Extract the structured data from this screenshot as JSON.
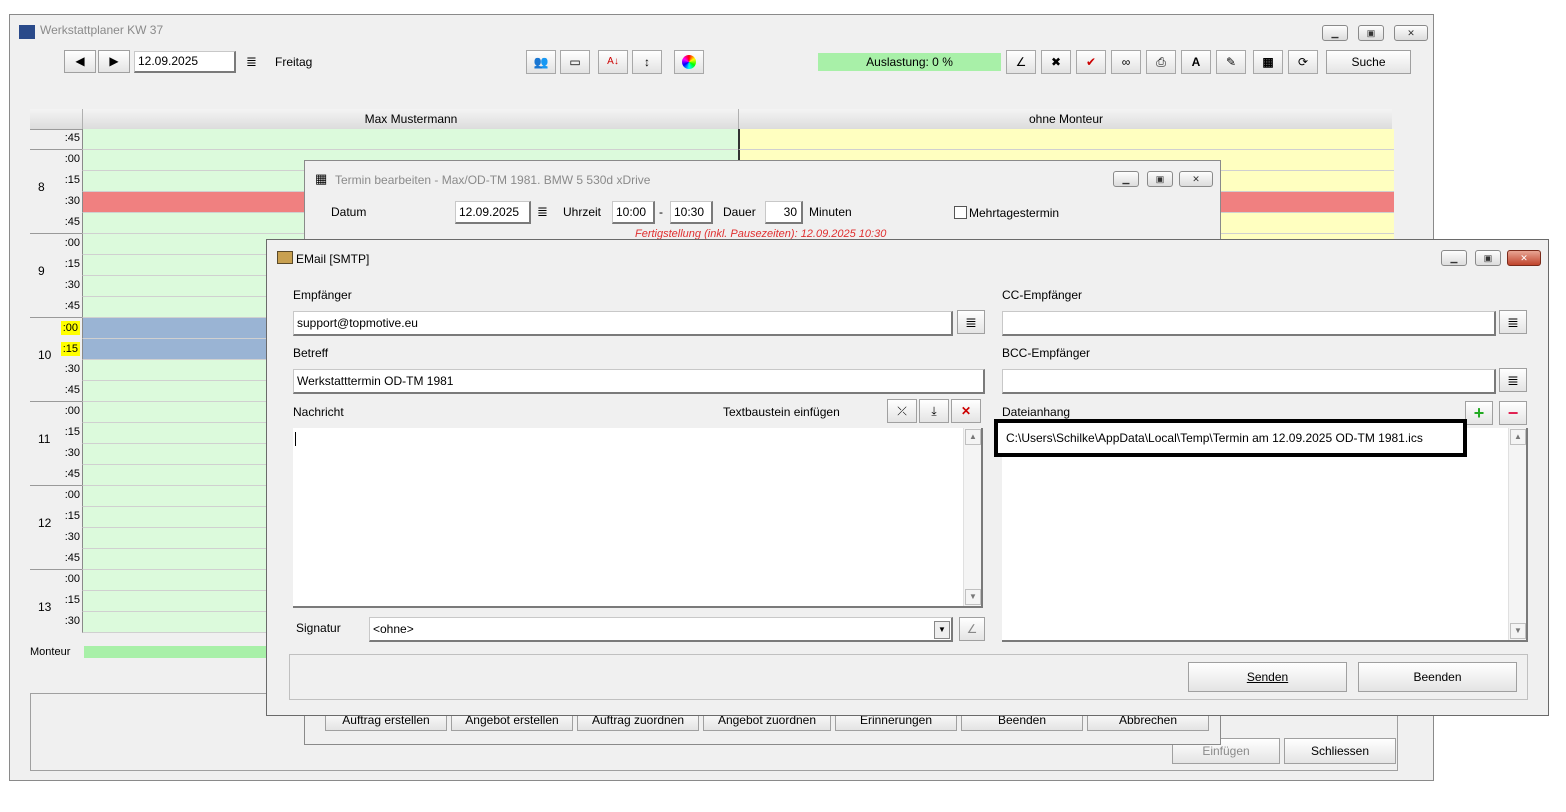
{
  "main": {
    "title": "Werkstattplaner KW 37",
    "date": "12.09.2025",
    "weekday": "Freitag",
    "auslastung": "Auslastung: 0 %",
    "suche_label": "Suche",
    "col1": "Max Mustermann",
    "col2": "ohne Monteur",
    "monteur_label": "Monteur",
    "einfuegen_label": "Einfügen",
    "schliessen_label": "Schliessen",
    "hours": [
      "8",
      "9",
      "10",
      "11",
      "12",
      "13"
    ],
    "slots": [
      ":45",
      ":00",
      ":15",
      ":30",
      ":45",
      ":00",
      ":15",
      ":30",
      ":45",
      ":00",
      ":15",
      ":30",
      ":45",
      ":00",
      ":15",
      ":30",
      ":45",
      ":00",
      ":15",
      ":30",
      ":45",
      ":00",
      ":15",
      ":30"
    ],
    "colors": {
      "grid_green": "#dcfadc",
      "grid_yellow": "#ffffc0",
      "grid_red": "#f08080",
      "grid_blue": "#9ab4d4",
      "slot_highlight": "#ffff00",
      "auslastung_bg": "#a8f0a8"
    }
  },
  "termin": {
    "title": "Termin bearbeiten - Max/OD-TM 1981. BMW 5 530d xDrive",
    "datum_label": "Datum",
    "datum_value": "12.09.2025",
    "uhrzeit_label": "Uhrzeit",
    "von": "10:00",
    "bis": "10:30",
    "dash": "-",
    "dauer_label": "Dauer",
    "dauer_value": "30",
    "minuten_label": "Minuten",
    "mehrtages_label": "Mehrtagestermin",
    "fertigstellung": "Fertigstellung (inkl. Pausezeiten): 12.09.2025 10:30",
    "buttons": [
      "Auftrag erstellen",
      "Angebot erstellen",
      "Auftrag zuordnen",
      "Angebot zuordnen",
      "Erinnerungen",
      "Beenden",
      "Abbrechen"
    ]
  },
  "email": {
    "title": "EMail [SMTP]",
    "empfaenger_label": "Empfänger",
    "empfaenger_value": "support@topmotive.eu",
    "cc_label": "CC-Empfänger",
    "cc_value": "",
    "betreff_label": "Betreff",
    "betreff_value": "Werkstatttermin OD-TM 1981",
    "bcc_label": "BCC-Empfänger",
    "bcc_value": "",
    "nachricht_label": "Nachricht",
    "textbaustein_label": "Textbaustein einfügen",
    "dateianhang_label": "Dateianhang",
    "attachment": "C:\\Users\\Schilke\\AppData\\Local\\Temp\\Termin am 12.09.2025 OD-TM 1981.ics",
    "signatur_label": "Signatur",
    "signatur_value": "<ohne>",
    "senden_label": "Senden",
    "beenden_label": "Beenden"
  }
}
